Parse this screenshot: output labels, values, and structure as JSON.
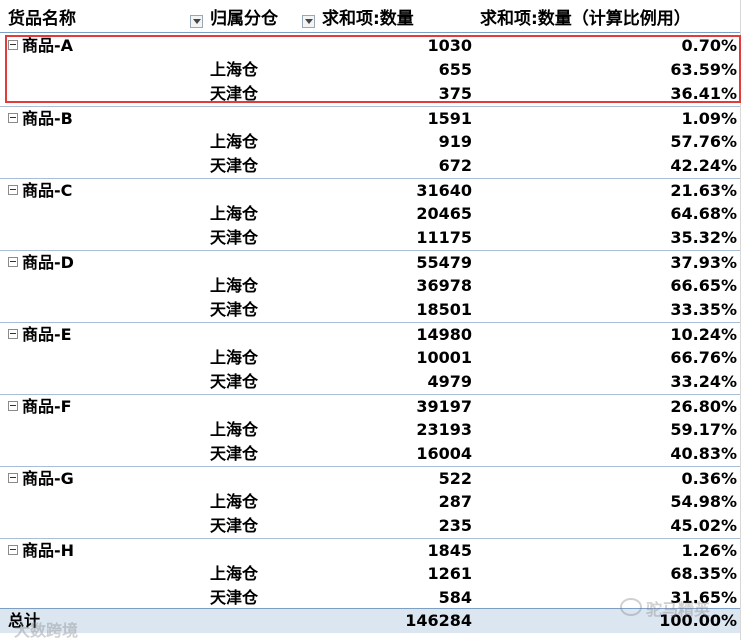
{
  "header": {
    "product_name": "货品名称",
    "warehouse": "归属分仓",
    "sum_qty": "求和项:数量",
    "sum_qty_pct": "求和项:数量（计算比例用）"
  },
  "groups": [
    {
      "name": "商品-A",
      "qty": "1030",
      "pct": "0.70%",
      "rows": [
        {
          "wh": "上海仓",
          "qty": "655",
          "pct": "63.59%"
        },
        {
          "wh": "天津仓",
          "qty": "375",
          "pct": "36.41%"
        }
      ]
    },
    {
      "name": "商品-B",
      "qty": "1591",
      "pct": "1.09%",
      "rows": [
        {
          "wh": "上海仓",
          "qty": "919",
          "pct": "57.76%"
        },
        {
          "wh": "天津仓",
          "qty": "672",
          "pct": "42.24%"
        }
      ]
    },
    {
      "name": "商品-C",
      "qty": "31640",
      "pct": "21.63%",
      "rows": [
        {
          "wh": "上海仓",
          "qty": "20465",
          "pct": "64.68%"
        },
        {
          "wh": "天津仓",
          "qty": "11175",
          "pct": "35.32%"
        }
      ]
    },
    {
      "name": "商品-D",
      "qty": "55479",
      "pct": "37.93%",
      "rows": [
        {
          "wh": "上海仓",
          "qty": "36978",
          "pct": "66.65%"
        },
        {
          "wh": "天津仓",
          "qty": "18501",
          "pct": "33.35%"
        }
      ]
    },
    {
      "name": "商品-E",
      "qty": "14980",
      "pct": "10.24%",
      "rows": [
        {
          "wh": "上海仓",
          "qty": "10001",
          "pct": "66.76%"
        },
        {
          "wh": "天津仓",
          "qty": "4979",
          "pct": "33.24%"
        }
      ]
    },
    {
      "name": "商品-F",
      "qty": "39197",
      "pct": "26.80%",
      "rows": [
        {
          "wh": "上海仓",
          "qty": "23193",
          "pct": "59.17%"
        },
        {
          "wh": "天津仓",
          "qty": "16004",
          "pct": "40.83%"
        }
      ]
    },
    {
      "name": "商品-G",
      "qty": "522",
      "pct": "0.36%",
      "rows": [
        {
          "wh": "上海仓",
          "qty": "287",
          "pct": "54.98%"
        },
        {
          "wh": "天津仓",
          "qty": "235",
          "pct": "45.02%"
        }
      ]
    },
    {
      "name": "商品-H",
      "qty": "1845",
      "pct": "1.26%",
      "rows": [
        {
          "wh": "上海仓",
          "qty": "1261",
          "pct": "68.35%"
        },
        {
          "wh": "天津仓",
          "qty": "584",
          "pct": "31.65%"
        }
      ]
    }
  ],
  "total": {
    "label": "总计",
    "qty": "146284",
    "pct": "100.00%"
  },
  "watermark": {
    "left": "大数跨境",
    "right": "驼马精英"
  },
  "colors": {
    "highlight": "#e23b3b",
    "total_bg": "#dce6f1",
    "group_border": "#a9bed6"
  },
  "icons": {
    "filter_dropdown": "dropdown-arrow-icon",
    "collapse": "minus-box-icon"
  }
}
